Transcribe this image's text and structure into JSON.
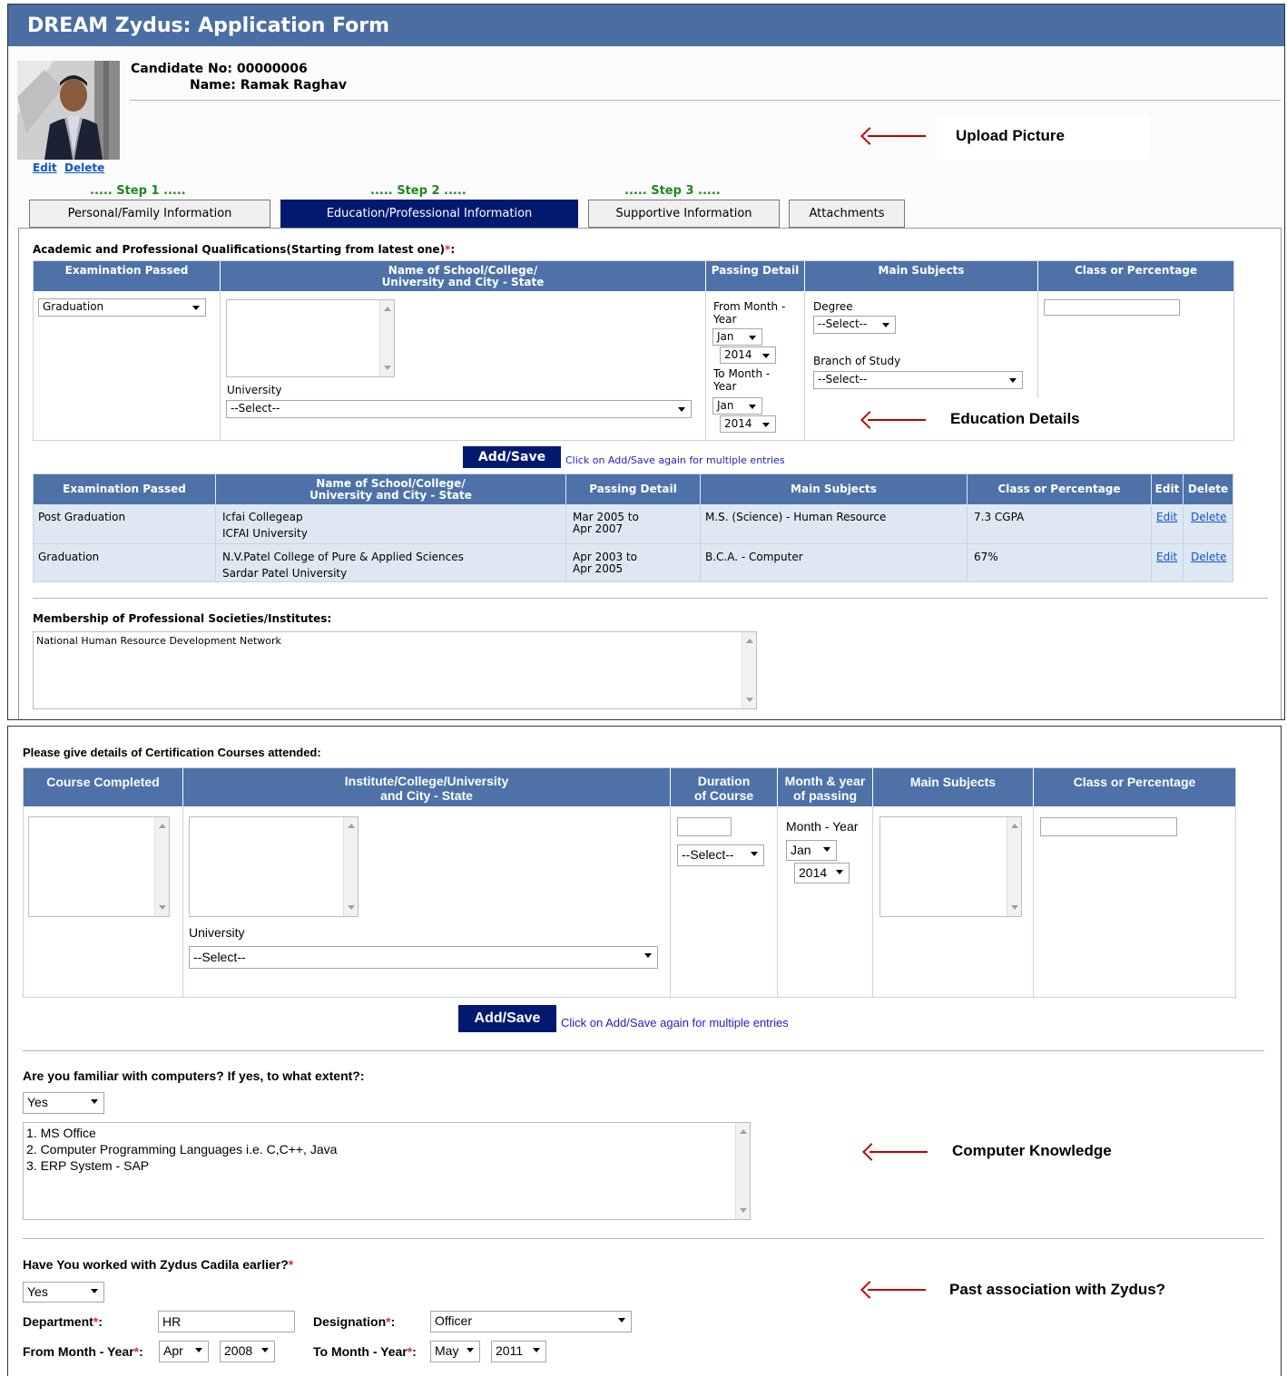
{
  "header": {
    "title": "DREAM Zydus: Application Form"
  },
  "candidate": {
    "number_line": "Candidate No: 00000006",
    "name_line": "Name: Ramak Raghav",
    "photo_edit": "Edit",
    "photo_delete": "Delete"
  },
  "callouts": {
    "upload": "Upload Picture",
    "education": "Education Details",
    "computer": "Computer Knowledge",
    "past": "Past association with Zydus?"
  },
  "steps": {
    "s1": "..... Step 1 .....",
    "s2": "..... Step 2 .....",
    "s3": "..... Step 3 ....."
  },
  "tabs": [
    {
      "label": "Personal/Family Information"
    },
    {
      "label": "Education/Professional Information"
    },
    {
      "label": "Supportive Information"
    },
    {
      "label": "Attachments"
    }
  ],
  "academic": {
    "heading": "Academic and Professional Qualifications(Starting from latest one)",
    "req_mark": "*",
    "colon": ":",
    "headers": {
      "exam": "Examination Passed",
      "school_l1": "Name of School/College/",
      "school_l2": "University and City - State",
      "passing": "Passing Detail",
      "subjects": "Main Subjects",
      "class": "Class or Percentage"
    },
    "form": {
      "exam_value": "Graduation",
      "university_label": "University",
      "university_value": "--Select--",
      "from_label_l1": "From Month -",
      "from_label_l2": "Year",
      "from_month": "Jan",
      "from_year": "2014",
      "to_label_l1": "To Month -",
      "to_label_l2": "Year",
      "to_month": "Jan",
      "to_year": "2014",
      "degree_label": "Degree",
      "degree_value": "--Select--",
      "branch_label": "Branch of Study",
      "branch_value": "--Select--",
      "class_value": ""
    },
    "add_button": "Add/Save",
    "add_hint": "Click on Add/Save again for multiple entries",
    "list_headers": {
      "exam": "Examination Passed",
      "school_l1": "Name of School/College/",
      "school_l2": "University and City - State",
      "passing": "Passing Detail",
      "subjects": "Main Subjects",
      "class": "Class or Percentage",
      "edit": "Edit",
      "delete": "Delete"
    },
    "rows": [
      {
        "exam": "Post Graduation",
        "school": "Icfai Collegeap",
        "university": "ICFAI University",
        "pass_l1": "Mar 2005 to",
        "pass_l2": "Apr 2007",
        "subjects": "M.S. (Science) - Human Resource",
        "class": "7.3 CGPA",
        "edit": "Edit",
        "delete": "Delete"
      },
      {
        "exam": "Graduation",
        "school": "N.V.Patel College of Pure & Applied Sciences",
        "university": "Sardar Patel University",
        "pass_l1": "Apr 2003 to",
        "pass_l2": "Apr 2005",
        "subjects": "B.C.A. - Computer",
        "class": "67%",
        "edit": "Edit",
        "delete": "Delete"
      }
    ]
  },
  "membership": {
    "heading": "Membership of Professional Societies/Institutes:",
    "value": "National Human Resource Development Network"
  },
  "certification": {
    "heading": "Please give details of Certification Courses attended:",
    "headers": {
      "course": "Course Completed",
      "institute_l1": "Institute/College/University",
      "institute_l2": "and City - State",
      "duration_l1": "Duration",
      "duration_l2": "of Course",
      "month_l1": "Month & year",
      "month_l2": "of passing",
      "subjects": "Main Subjects",
      "class": "Class or Percentage"
    },
    "form": {
      "university_label": "University",
      "university_value": "--Select--",
      "duration_unit": "--Select--",
      "month_year_label": "Month - Year",
      "month": "Jan",
      "year": "2014"
    },
    "add_button": "Add/Save",
    "add_hint": "Click on Add/Save again for multiple entries"
  },
  "computer": {
    "question": "Are you familiar with computers? If yes, to what extent?:",
    "answer": "Yes",
    "details": "1. MS Office\n2. Computer Programming Languages i.e. C,C++, Java\n3. ERP System - SAP"
  },
  "past": {
    "question": "Have You worked with Zydus Cadila earlier?",
    "req_mark": "*",
    "answer": "Yes",
    "department_label": "Department",
    "department_value": "HR",
    "designation_label": "Designation",
    "designation_value": "Officer",
    "from_label": "From Month - Year",
    "from_month": "Apr",
    "from_year": "2008",
    "to_label": "To Month - Year",
    "to_month": "May",
    "to_year": "2011",
    "colon": ":"
  }
}
